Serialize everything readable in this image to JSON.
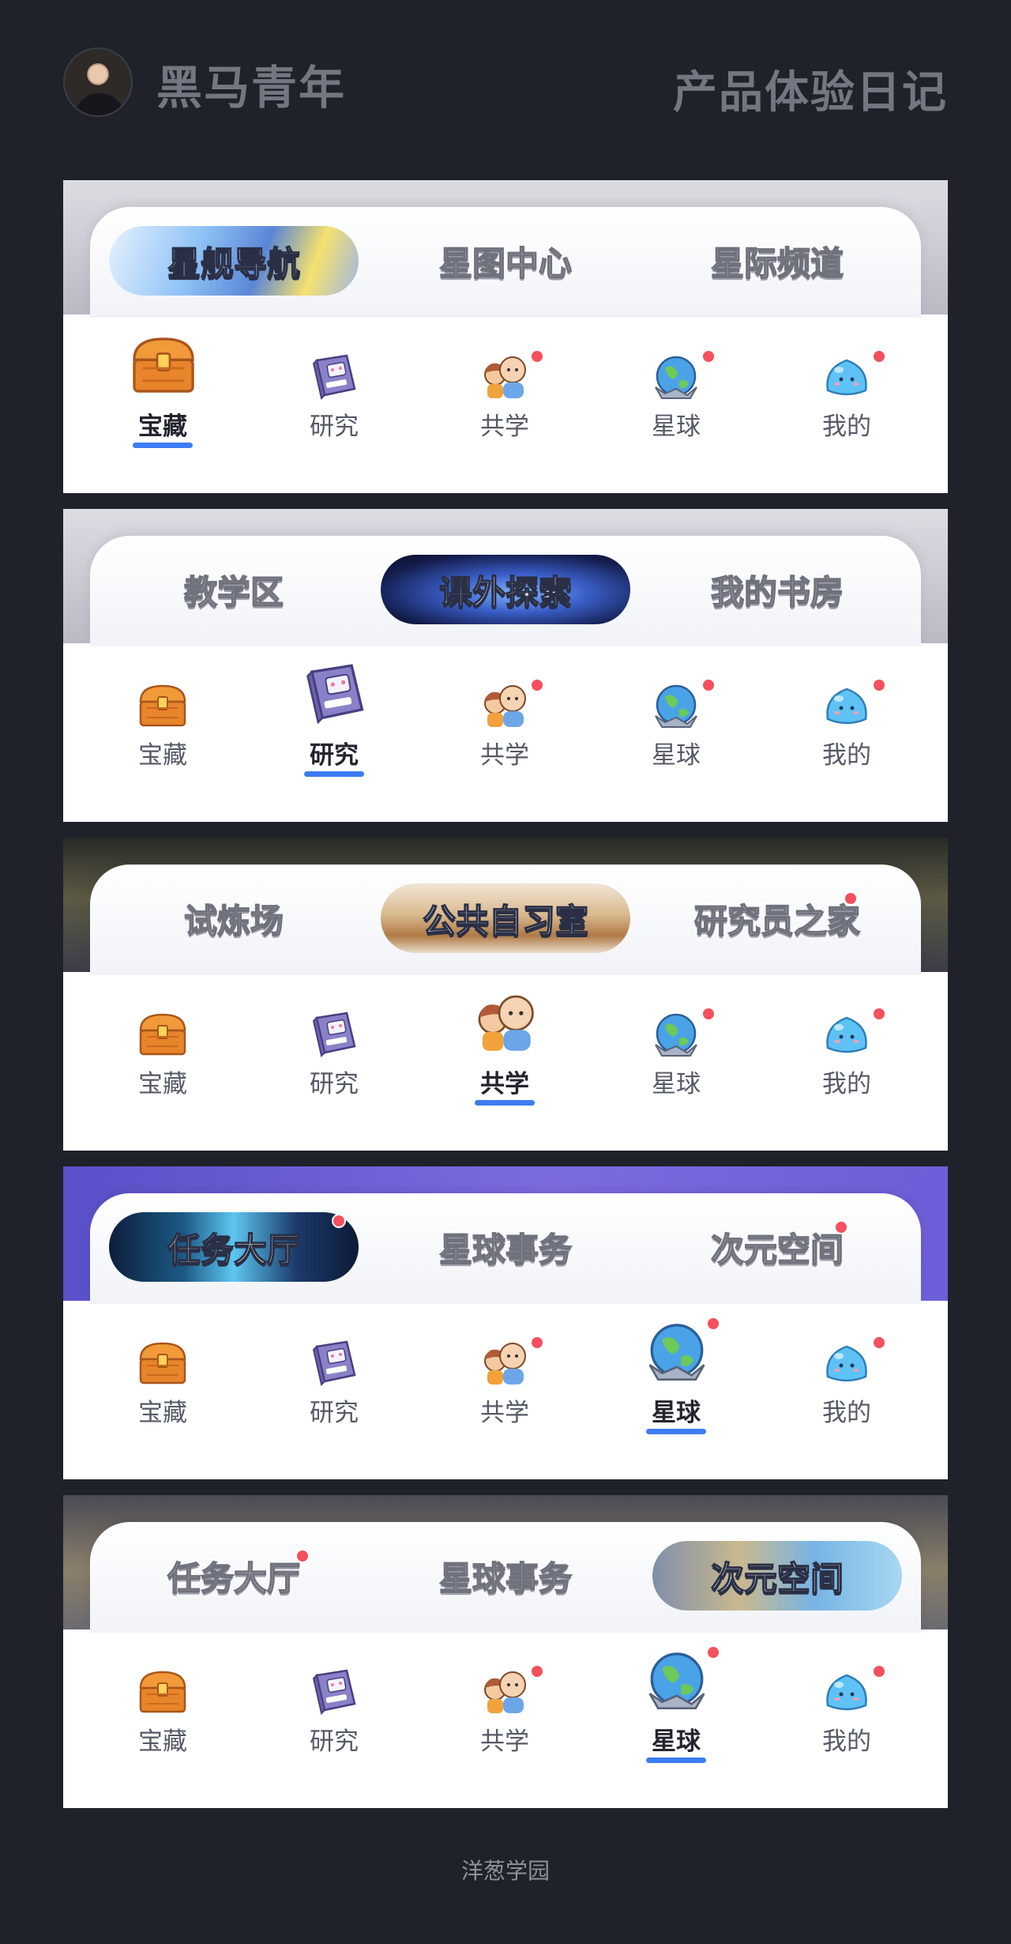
{
  "header": {
    "brand_name": "黑马青年",
    "diary_title": "产品体验日记"
  },
  "bottom_nav_labels": [
    "宝藏",
    "研究",
    "共学",
    "星球",
    "我的"
  ],
  "cards": [
    {
      "top_tabs": [
        "星舰导航",
        "星图中心",
        "星际频道"
      ],
      "active_top_tab": 0,
      "active_nav": 0
    },
    {
      "top_tabs": [
        "教学区",
        "课外探索",
        "我的书房"
      ],
      "active_top_tab": 1,
      "active_nav": 1
    },
    {
      "top_tabs": [
        "试炼场",
        "公共自习室",
        "研究员之家"
      ],
      "active_top_tab": 1,
      "active_nav": 2
    },
    {
      "top_tabs": [
        "任务大厅",
        "星球事务",
        "次元空间"
      ],
      "active_top_tab": 0,
      "active_nav": 3
    },
    {
      "top_tabs": [
        "任务大厅",
        "星球事务",
        "次元空间"
      ],
      "active_top_tab": 2,
      "active_nav": 3
    }
  ],
  "nav_icons": [
    "treasure-chest-icon",
    "study-book-icon",
    "two-kids-icon",
    "planet-globe-icon",
    "blue-blob-icon"
  ],
  "colors": {
    "accent": "#3d7cf2",
    "badge": "#f4505d",
    "page_bg": "#1f222b"
  },
  "footer": {
    "text": "洋葱学园"
  }
}
